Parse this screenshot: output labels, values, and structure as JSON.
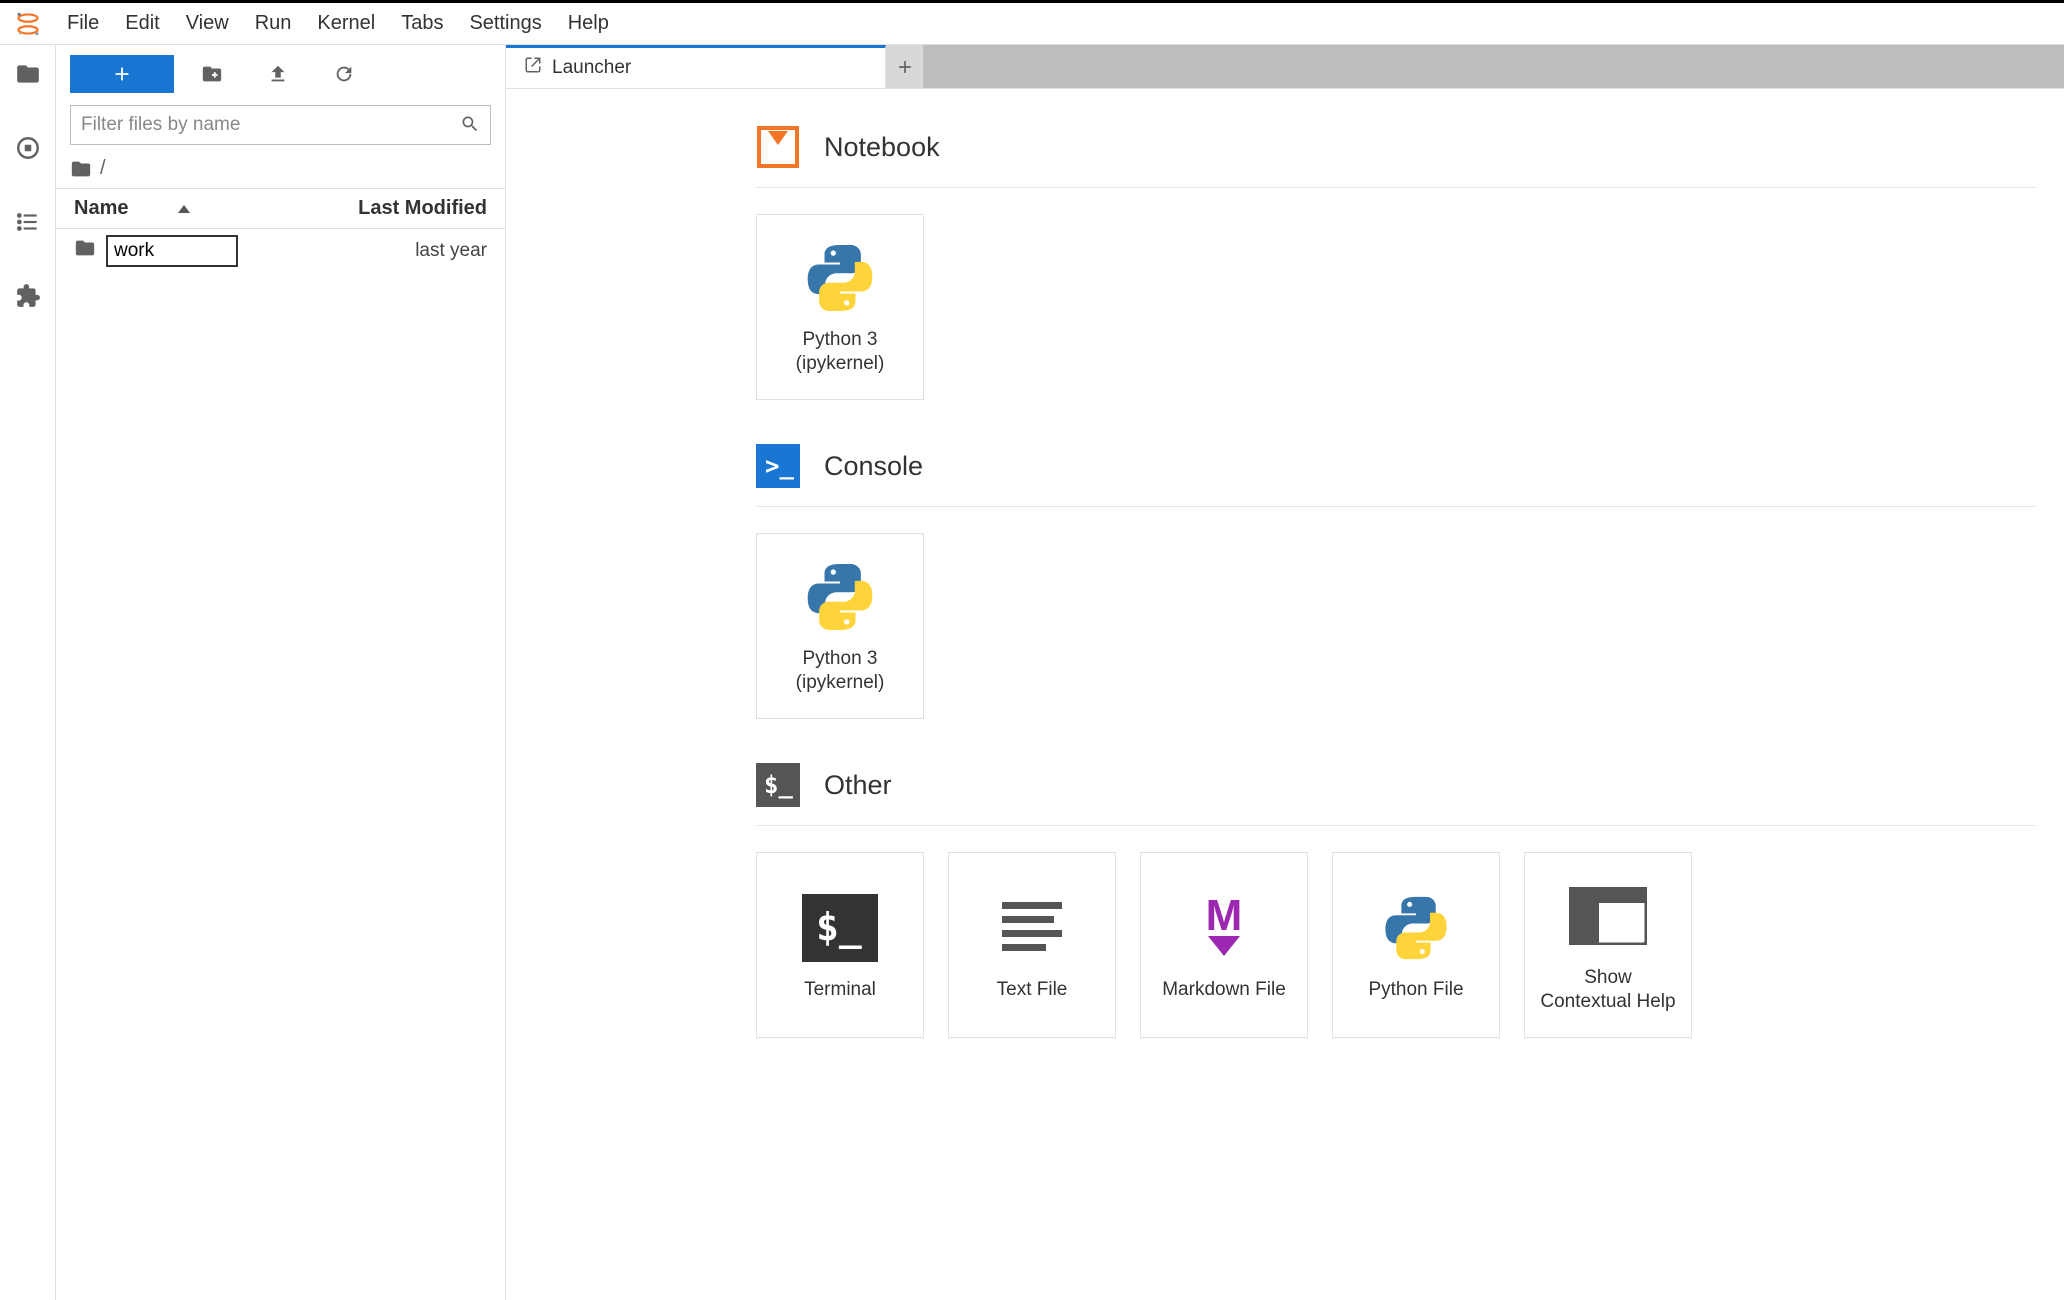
{
  "menubar": {
    "items": [
      "File",
      "Edit",
      "View",
      "Run",
      "Kernel",
      "Tabs",
      "Settings",
      "Help"
    ]
  },
  "sidebar": {
    "filter_placeholder": "Filter files by name",
    "breadcrumb": "/",
    "columns": {
      "name": "Name",
      "modified": "Last Modified"
    },
    "items": [
      {
        "name": "work",
        "modified": "last year",
        "renaming": true
      }
    ]
  },
  "tabs": {
    "active": "Launcher"
  },
  "launcher": {
    "sections": [
      {
        "title": "Notebook",
        "cards": [
          {
            "label": "Python 3\n(ipykernel)",
            "icon": "python"
          }
        ]
      },
      {
        "title": "Console",
        "cards": [
          {
            "label": "Python 3\n(ipykernel)",
            "icon": "python"
          }
        ]
      },
      {
        "title": "Other",
        "cards": [
          {
            "label": "Terminal",
            "icon": "terminal"
          },
          {
            "label": "Text File",
            "icon": "textfile"
          },
          {
            "label": "Markdown File",
            "icon": "markdown"
          },
          {
            "label": "Python File",
            "icon": "python"
          },
          {
            "label": "Show\nContextual Help",
            "icon": "contextual"
          }
        ]
      }
    ]
  }
}
